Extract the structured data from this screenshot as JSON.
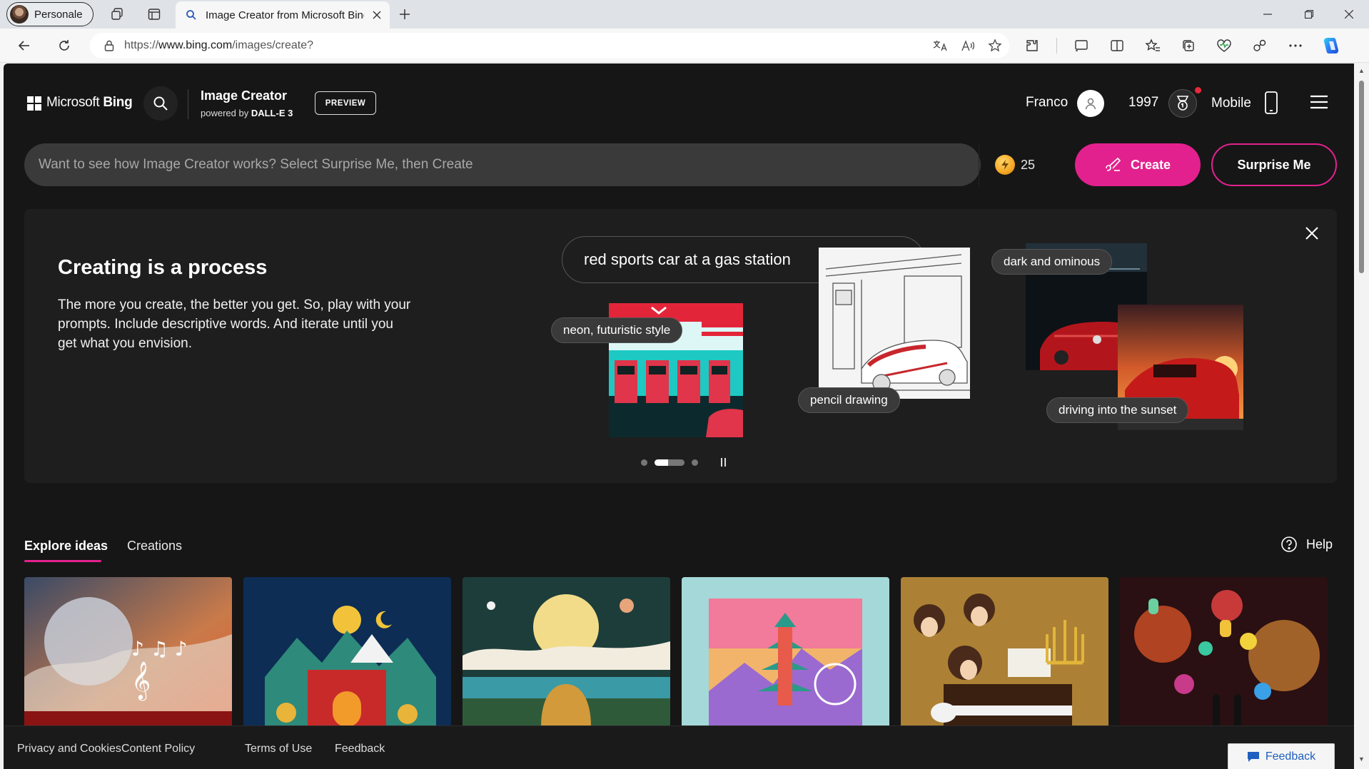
{
  "browser": {
    "profile_label": "Personale",
    "tab_title": "Image Creator from Microsoft Bing",
    "url_scheme": "https://",
    "url_host": "www.bing.com",
    "url_path": "/images/create?"
  },
  "header": {
    "brand_prefix": "Microsoft ",
    "brand_name": "Bing",
    "product_title": "Image Creator",
    "product_subtitle_prefix": "powered by ",
    "product_subtitle_model": "DALL-E 3",
    "preview_badge": "PREVIEW",
    "user_name": "Franco",
    "rewards_points": "1997",
    "mobile_label": "Mobile"
  },
  "prompt": {
    "placeholder": "Want to see how Image Creator works? Select Surprise Me, then Create",
    "boosts": "25",
    "create_label": "Create",
    "surprise_label": "Surprise Me"
  },
  "info_card": {
    "title": "Creating is a process",
    "text": "The more you create, the better you get. So, play with your prompts. Include descriptive words. And iterate until you get what you envision.",
    "demo_prompt": "red sports car at a gas station",
    "chips": {
      "neon": "neon, futuristic style",
      "pencil": "pencil drawing",
      "dark": "dark and ominous",
      "sunset": "driving into the sunset"
    },
    "carousel_active_index": 1,
    "carousel_count": 3
  },
  "tabs": {
    "explore": "Explore ideas",
    "creations": "Creations",
    "help": "Help"
  },
  "footer": {
    "privacy": "Privacy and Cookies",
    "content_policy": "Content Policy",
    "terms": "Terms of Use",
    "feedback_link": "Feedback",
    "feedback_button": "Feedback"
  },
  "colors": {
    "accent": "#e3218e",
    "page_bg": "#161616",
    "card_bg": "#1e1e1e"
  }
}
